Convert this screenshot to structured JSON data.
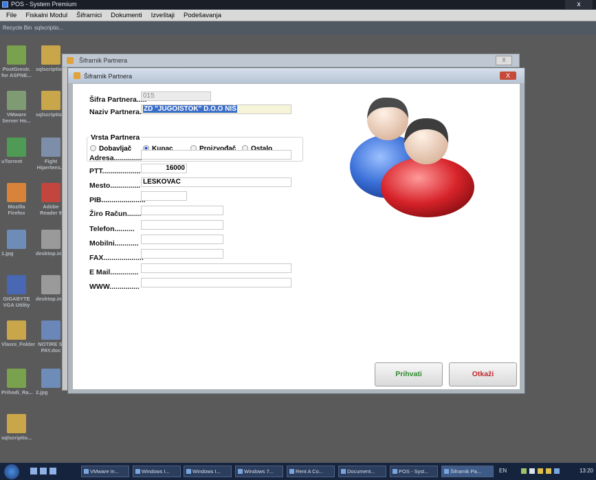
{
  "app": {
    "title": "POS - System Premium",
    "close_label": "x"
  },
  "menubar": {
    "items": [
      "File",
      "Fiskalni Modul",
      "Šifrarnici",
      "Dokumenti",
      "Izveštaji",
      "Podešavanja"
    ]
  },
  "desktop": {
    "top_labels": [
      "Recycle Bin",
      "sqlscriptio..."
    ],
    "icons": [
      {
        "label": "PostGrestr. for ASPNE...",
        "color": "#7aa14e"
      },
      {
        "label": "sqlscriptio...",
        "color": "#caa64a"
      },
      {
        "label": "VMware Server Ho...",
        "color": "#7f9b73"
      },
      {
        "label": "sqlscriptio...",
        "color": "#caa64a"
      },
      {
        "label": "uTorrent",
        "color": "#4f9a55"
      },
      {
        "label": "Fight Hipertens...",
        "color": "#7d8fa8"
      },
      {
        "label": "Mozilla Firefox",
        "color": "#d7843a"
      },
      {
        "label": "Adobe Reader 9",
        "color": "#c2453e"
      },
      {
        "label": "1.jpg",
        "color": "#6d8db8"
      },
      {
        "label": "desktop.ini",
        "color": "#9a9a9a"
      },
      {
        "label": "GIGABYTE VGA Utility",
        "color": "#4967b3"
      },
      {
        "label": "desktop.ini",
        "color": "#9a9a9a"
      },
      {
        "label": "Vlasni_Folder",
        "color": "#caa64a"
      },
      {
        "label": "NOTIRE SI PAY.doc",
        "color": "#6b86b8"
      },
      {
        "label": "Prihodi_Ra...",
        "color": "#7aa14e"
      },
      {
        "label": "2.jpg",
        "color": "#6d8db8"
      },
      {
        "label": "sqlscriptio...",
        "color": "#caa64a"
      }
    ]
  },
  "background_window": {
    "title": "Šifrarnik Partnera",
    "close_label": "X"
  },
  "dialog": {
    "title": "Šifrarnik Partnera",
    "close_label": "X",
    "fields": {
      "sifra": {
        "label": "Šifra Partnera.....",
        "value": "015"
      },
      "naziv": {
        "label": "Naziv Partnera....",
        "value": "ZD \"JUGOISTOK\" D.O.O NIŠ"
      },
      "adresa": {
        "label": "Adresa..............",
        "value": ""
      },
      "ptt": {
        "label": "PTT....................",
        "value": "16000"
      },
      "mesto": {
        "label": "Mesto...............",
        "value": "LESKOVAC"
      },
      "pib": {
        "label": "PIB......................",
        "value": ""
      },
      "ziro": {
        "label": "Žiro Račun.......",
        "value": ""
      },
      "telefon": {
        "label": "Telefon..........",
        "value": ""
      },
      "mobilni": {
        "label": "Mobilni............",
        "value": ""
      },
      "fax": {
        "label": "FAX....................",
        "value": ""
      },
      "email": {
        "label": "E Mail..............",
        "value": ""
      },
      "www": {
        "label": "WWW...............",
        "value": ""
      }
    },
    "vrsta": {
      "title": "Vrsta Partnera",
      "options": [
        {
          "label": "Dobavljač",
          "selected": false
        },
        {
          "label": "Kupac",
          "selected": true
        },
        {
          "label": "Proizvođač",
          "selected": false
        },
        {
          "label": "Ostalo",
          "selected": false
        }
      ]
    },
    "buttons": {
      "accept": {
        "label": "Prihvati",
        "color": "#2e8a2e"
      },
      "cancel": {
        "label": "Otkaži",
        "color": "#c0272d"
      }
    },
    "graphic": {
      "icon": "users-icon",
      "colors": {
        "blue": "#3a6fd8",
        "red": "#d7232a"
      }
    }
  },
  "taskbar": {
    "items": [
      "VMware In...",
      "Windows I...",
      "Windows I...",
      "Windows 7...",
      "Rent A Co...",
      "Document...",
      "POS - Syst...",
      "Šifrarnik Pa..."
    ],
    "language": "EN",
    "clock": "13:20"
  }
}
